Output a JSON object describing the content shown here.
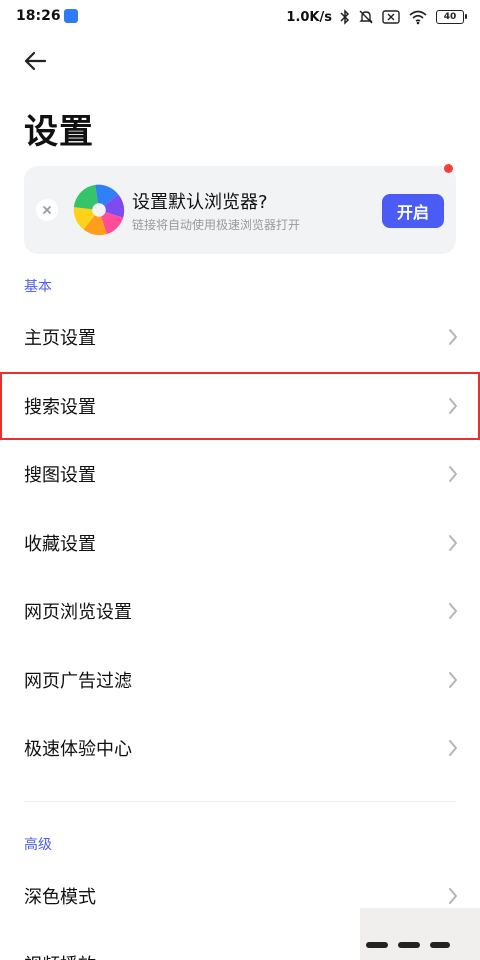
{
  "status_bar": {
    "time": "18:26",
    "network_speed": "1.0K/s",
    "battery": "40",
    "icons": [
      "app-notification-icon",
      "bluetooth-icon",
      "mute-icon",
      "sim-off-icon",
      "wifi-icon",
      "battery-icon"
    ]
  },
  "header": {
    "back_icon": "arrow-left-icon",
    "title": "设置"
  },
  "promo": {
    "title": "设置默认浏览器?",
    "subtitle": "链接将自动使用极速浏览器打开",
    "button_label": "开启",
    "accent_color": "#4a5cf5",
    "dot_color": "#f0413c"
  },
  "sections": {
    "basic_title": "基本",
    "advanced_title": "高级"
  },
  "basic_items": [
    {
      "label": "主页设置"
    },
    {
      "label": "搜索设置"
    },
    {
      "label": "搜图设置"
    },
    {
      "label": "收藏设置"
    },
    {
      "label": "网页浏览设置"
    },
    {
      "label": "网页广告过滤"
    },
    {
      "label": "极速体验中心"
    }
  ],
  "advanced_items": [
    {
      "label": "深色模式"
    },
    {
      "label": "视频播放"
    }
  ],
  "selected_item": "搜索设置",
  "colors": {
    "section_header": "#4a5cf5",
    "selection_outline": "#e6312d"
  }
}
